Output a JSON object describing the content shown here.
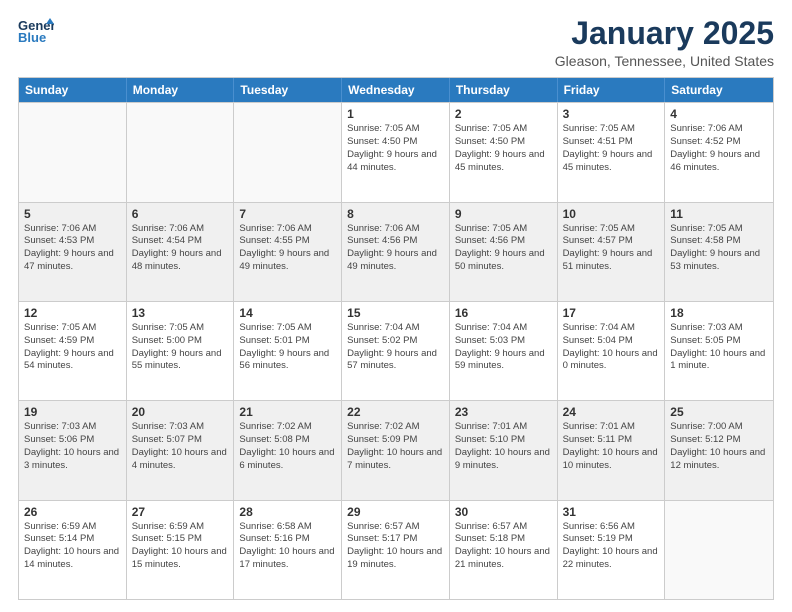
{
  "logo": {
    "line1": "General",
    "line2": "Blue"
  },
  "title": "January 2025",
  "subtitle": "Gleason, Tennessee, United States",
  "days_of_week": [
    "Sunday",
    "Monday",
    "Tuesday",
    "Wednesday",
    "Thursday",
    "Friday",
    "Saturday"
  ],
  "weeks": [
    [
      {
        "day": "",
        "empty": true
      },
      {
        "day": "",
        "empty": true
      },
      {
        "day": "",
        "empty": true
      },
      {
        "day": "1",
        "sunrise": "7:05 AM",
        "sunset": "4:50 PM",
        "daylight": "9 hours and 44 minutes."
      },
      {
        "day": "2",
        "sunrise": "7:05 AM",
        "sunset": "4:50 PM",
        "daylight": "9 hours and 45 minutes."
      },
      {
        "day": "3",
        "sunrise": "7:05 AM",
        "sunset": "4:51 PM",
        "daylight": "9 hours and 45 minutes."
      },
      {
        "day": "4",
        "sunrise": "7:06 AM",
        "sunset": "4:52 PM",
        "daylight": "9 hours and 46 minutes."
      }
    ],
    [
      {
        "day": "5",
        "sunrise": "7:06 AM",
        "sunset": "4:53 PM",
        "daylight": "9 hours and 47 minutes."
      },
      {
        "day": "6",
        "sunrise": "7:06 AM",
        "sunset": "4:54 PM",
        "daylight": "9 hours and 48 minutes."
      },
      {
        "day": "7",
        "sunrise": "7:06 AM",
        "sunset": "4:55 PM",
        "daylight": "9 hours and 49 minutes."
      },
      {
        "day": "8",
        "sunrise": "7:06 AM",
        "sunset": "4:56 PM",
        "daylight": "9 hours and 49 minutes."
      },
      {
        "day": "9",
        "sunrise": "7:05 AM",
        "sunset": "4:56 PM",
        "daylight": "9 hours and 50 minutes."
      },
      {
        "day": "10",
        "sunrise": "7:05 AM",
        "sunset": "4:57 PM",
        "daylight": "9 hours and 51 minutes."
      },
      {
        "day": "11",
        "sunrise": "7:05 AM",
        "sunset": "4:58 PM",
        "daylight": "9 hours and 53 minutes."
      }
    ],
    [
      {
        "day": "12",
        "sunrise": "7:05 AM",
        "sunset": "4:59 PM",
        "daylight": "9 hours and 54 minutes."
      },
      {
        "day": "13",
        "sunrise": "7:05 AM",
        "sunset": "5:00 PM",
        "daylight": "9 hours and 55 minutes."
      },
      {
        "day": "14",
        "sunrise": "7:05 AM",
        "sunset": "5:01 PM",
        "daylight": "9 hours and 56 minutes."
      },
      {
        "day": "15",
        "sunrise": "7:04 AM",
        "sunset": "5:02 PM",
        "daylight": "9 hours and 57 minutes."
      },
      {
        "day": "16",
        "sunrise": "7:04 AM",
        "sunset": "5:03 PM",
        "daylight": "9 hours and 59 minutes."
      },
      {
        "day": "17",
        "sunrise": "7:04 AM",
        "sunset": "5:04 PM",
        "daylight": "10 hours and 0 minutes."
      },
      {
        "day": "18",
        "sunrise": "7:03 AM",
        "sunset": "5:05 PM",
        "daylight": "10 hours and 1 minute."
      }
    ],
    [
      {
        "day": "19",
        "sunrise": "7:03 AM",
        "sunset": "5:06 PM",
        "daylight": "10 hours and 3 minutes."
      },
      {
        "day": "20",
        "sunrise": "7:03 AM",
        "sunset": "5:07 PM",
        "daylight": "10 hours and 4 minutes."
      },
      {
        "day": "21",
        "sunrise": "7:02 AM",
        "sunset": "5:08 PM",
        "daylight": "10 hours and 6 minutes."
      },
      {
        "day": "22",
        "sunrise": "7:02 AM",
        "sunset": "5:09 PM",
        "daylight": "10 hours and 7 minutes."
      },
      {
        "day": "23",
        "sunrise": "7:01 AM",
        "sunset": "5:10 PM",
        "daylight": "10 hours and 9 minutes."
      },
      {
        "day": "24",
        "sunrise": "7:01 AM",
        "sunset": "5:11 PM",
        "daylight": "10 hours and 10 minutes."
      },
      {
        "day": "25",
        "sunrise": "7:00 AM",
        "sunset": "5:12 PM",
        "daylight": "10 hours and 12 minutes."
      }
    ],
    [
      {
        "day": "26",
        "sunrise": "6:59 AM",
        "sunset": "5:14 PM",
        "daylight": "10 hours and 14 minutes."
      },
      {
        "day": "27",
        "sunrise": "6:59 AM",
        "sunset": "5:15 PM",
        "daylight": "10 hours and 15 minutes."
      },
      {
        "day": "28",
        "sunrise": "6:58 AM",
        "sunset": "5:16 PM",
        "daylight": "10 hours and 17 minutes."
      },
      {
        "day": "29",
        "sunrise": "6:57 AM",
        "sunset": "5:17 PM",
        "daylight": "10 hours and 19 minutes."
      },
      {
        "day": "30",
        "sunrise": "6:57 AM",
        "sunset": "5:18 PM",
        "daylight": "10 hours and 21 minutes."
      },
      {
        "day": "31",
        "sunrise": "6:56 AM",
        "sunset": "5:19 PM",
        "daylight": "10 hours and 22 minutes."
      },
      {
        "day": "",
        "empty": true
      }
    ]
  ]
}
